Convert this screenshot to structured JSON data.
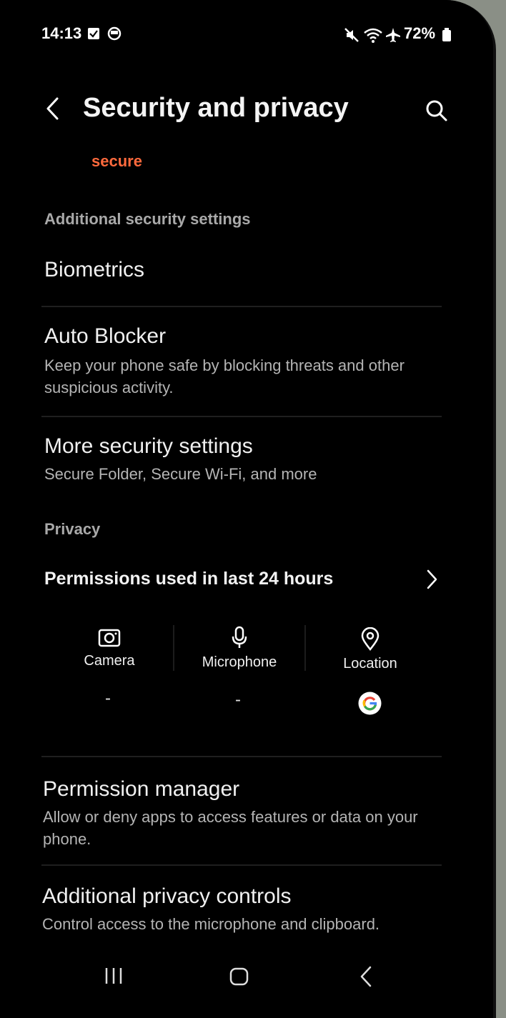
{
  "status_bar": {
    "time": "14:13",
    "battery": "72%",
    "icons": [
      "checkbox-icon",
      "circle-status-icon",
      "mute-icon",
      "wifi-icon",
      "airplane-icon",
      "battery-icon"
    ]
  },
  "header": {
    "title": "Security and privacy",
    "back_icon": "back-arrow-icon",
    "search_icon": "search-icon"
  },
  "partial_text": "secure",
  "sections": {
    "additional_security": "Additional security settings",
    "privacy": "Privacy"
  },
  "items": {
    "biometrics": {
      "title": "Biometrics"
    },
    "auto_blocker": {
      "title": "Auto Blocker",
      "subtitle": "Keep your phone safe by blocking threats and other suspicious activity."
    },
    "more_security": {
      "title": "More security settings",
      "subtitle": "Secure Folder, Secure Wi-Fi, and more"
    },
    "permission_manager": {
      "title": "Permission manager",
      "subtitle": "Allow or deny apps to access features or data on your phone."
    },
    "additional_privacy": {
      "title": "Additional privacy controls",
      "subtitle": "Control access to the microphone and clipboard."
    }
  },
  "permissions_24h": {
    "title": "Permissions used in last 24 hours",
    "columns": [
      {
        "label": "Camera",
        "icon": "camera-icon",
        "value": "-"
      },
      {
        "label": "Microphone",
        "icon": "microphone-icon",
        "value": "-"
      },
      {
        "label": "Location",
        "icon": "location-icon",
        "value_icon": "google-app-icon"
      }
    ]
  },
  "colors": {
    "background": "#000000",
    "accent_orange": "#ff6a3d",
    "secondary_text": "#b4b4b4"
  }
}
